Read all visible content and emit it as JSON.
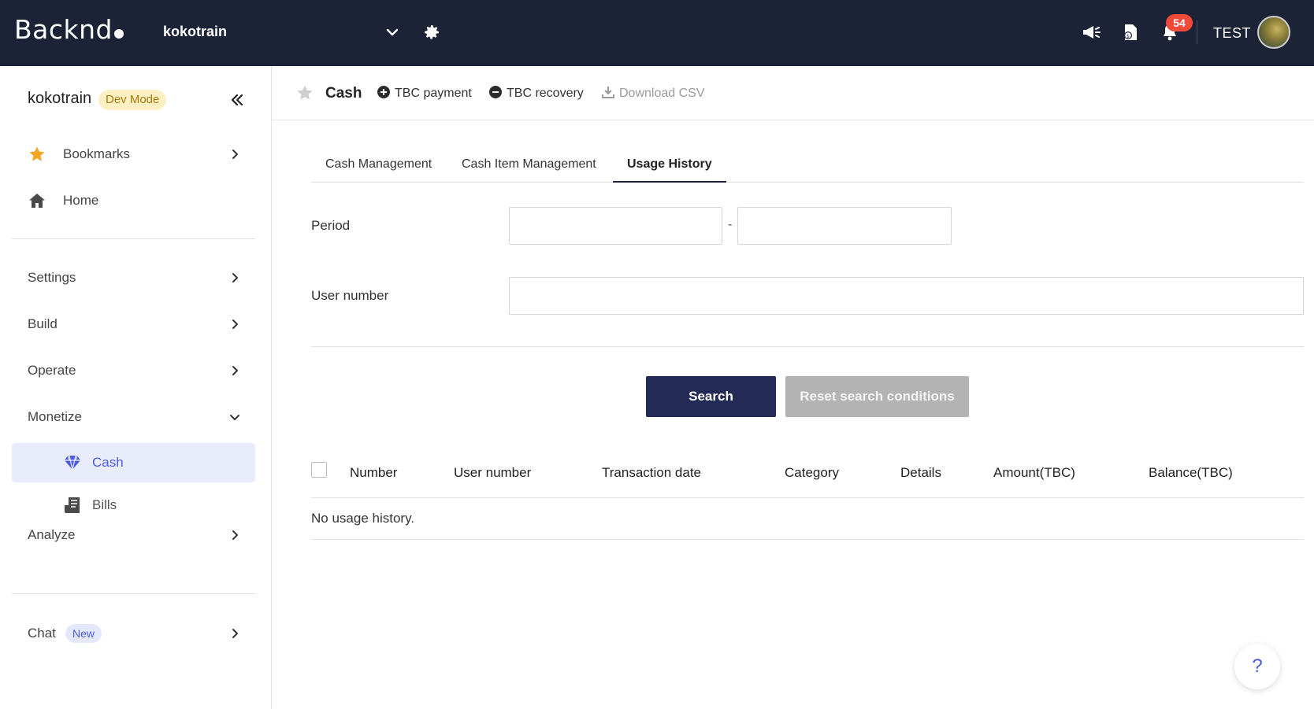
{
  "topbar": {
    "logo": "Backnd",
    "project": "kokotrain",
    "badge_count": "54",
    "user": "TEST"
  },
  "sidebar": {
    "project": "kokotrain",
    "mode_badge": "Dev Mode",
    "bookmarks": "Bookmarks",
    "home": "Home",
    "items": [
      {
        "label": "Settings"
      },
      {
        "label": "Build"
      },
      {
        "label": "Operate"
      },
      {
        "label": "Monetize"
      },
      {
        "label": "Analyze"
      }
    ],
    "sub_items": [
      {
        "label": "Cash"
      },
      {
        "label": "Bills"
      }
    ],
    "chat": "Chat",
    "chat_badge": "New"
  },
  "header": {
    "title": "Cash",
    "actions": [
      {
        "label": "TBC payment"
      },
      {
        "label": "TBC recovery"
      },
      {
        "label": "Download CSV"
      }
    ]
  },
  "tabs": [
    {
      "label": "Cash Management"
    },
    {
      "label": "Cash Item Management"
    },
    {
      "label": "Usage History"
    }
  ],
  "form": {
    "period_label": "Period",
    "period_separator": "-",
    "period_start": "",
    "period_end": "",
    "user_number_label": "User number",
    "user_number_value": ""
  },
  "buttons": {
    "search": "Search",
    "reset": "Reset search conditions"
  },
  "table": {
    "columns": [
      "Number",
      "User number",
      "Transaction date",
      "Category",
      "Details",
      "Amount(TBC)",
      "Balance(TBC)"
    ],
    "empty_message": "No usage history."
  },
  "help": "?",
  "colors": {
    "topbar_bg": "#1d2337",
    "primary_button": "#232a56",
    "accent": "#4d5be0",
    "notification_badge": "#ef4a3a",
    "star": "#f5a623"
  }
}
